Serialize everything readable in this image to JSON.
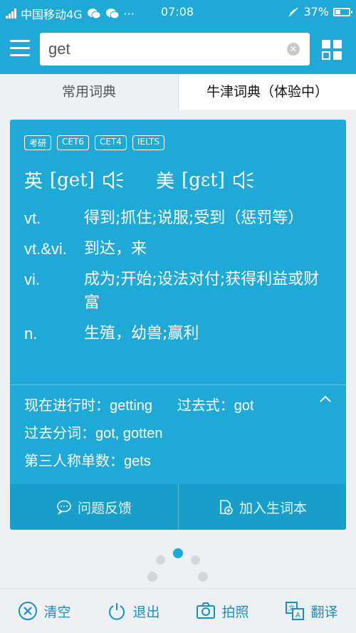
{
  "status": {
    "carrier": "中国移动4G",
    "time": "07:08",
    "battery": "37%",
    "more": "···"
  },
  "search": {
    "value": "get"
  },
  "tabs": [
    {
      "label": "常用词典"
    },
    {
      "label": "牛津词典（体验中）"
    }
  ],
  "badges": [
    "考研",
    "CET6",
    "CET4",
    "IELTS"
  ],
  "phonetics": {
    "uk_label": "英",
    "uk": "[get]",
    "us_label": "美",
    "us": "[gɛt]"
  },
  "definitions": [
    {
      "pos": "vt.",
      "text": "得到;抓住;说服;受到（惩罚等）"
    },
    {
      "pos": "vt.&vi.",
      "text": "到达，来"
    },
    {
      "pos": "vi.",
      "text": "成为;开始;设法对付;获得利益或财富"
    },
    {
      "pos": "n.",
      "text": "生殖，幼兽;赢利"
    }
  ],
  "forms": {
    "progressive_label": "现在进行时：",
    "progressive": "getting",
    "past_label": "过去式：",
    "past": "got",
    "participle_label": "过去分词：",
    "participle": "got, gotten",
    "third_label": "第三人称单数：",
    "third": "gets"
  },
  "card_footer": {
    "feedback": "问题反馈",
    "add_wordbook": "加入生词本"
  },
  "bottom_bar": {
    "clear": "清空",
    "exit": "退出",
    "photo": "拍照",
    "translate": "翻译"
  },
  "colors": {
    "accent": "#1ea9d6",
    "icon": "#1a8fc4"
  }
}
